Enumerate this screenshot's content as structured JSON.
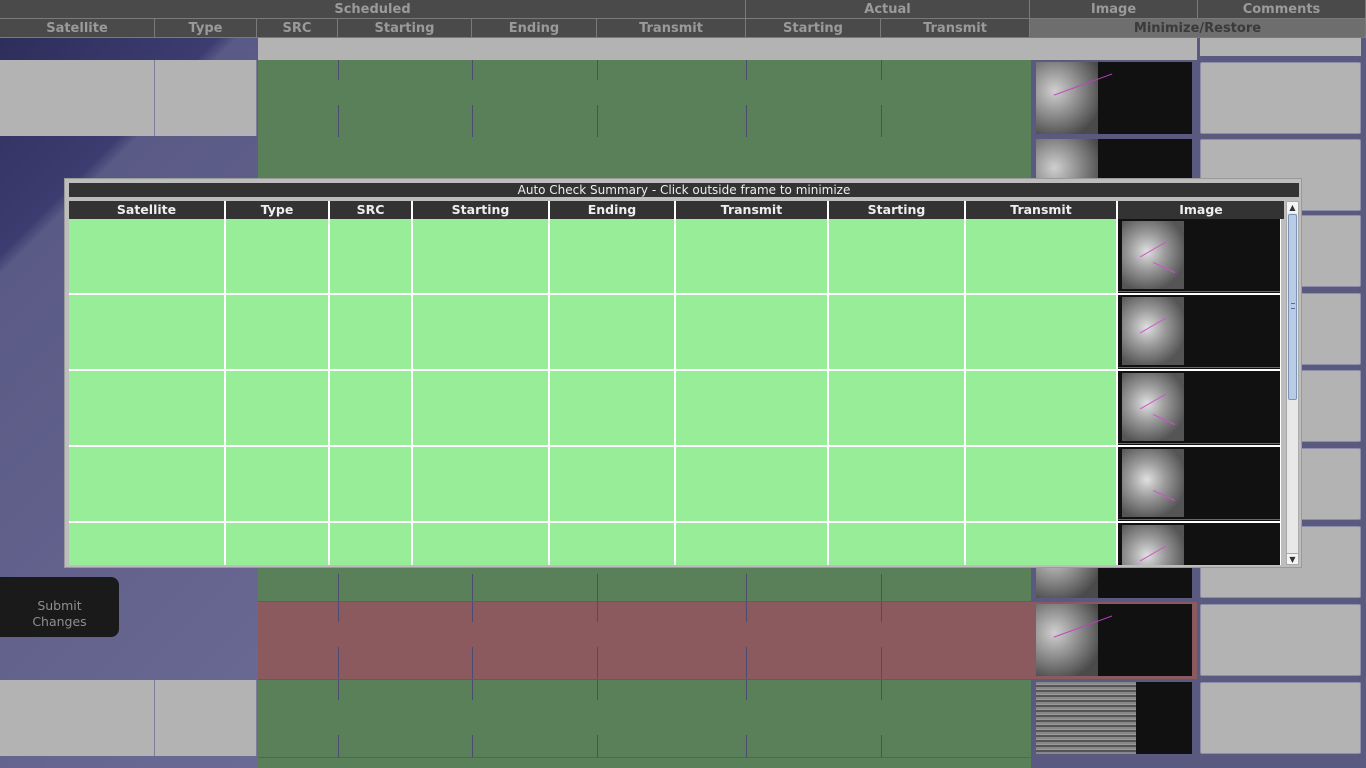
{
  "background": {
    "header_groups": [
      "Scheduled",
      "Actual",
      "Image",
      "Comments"
    ],
    "header_columns": [
      "Satellite",
      "Type",
      "SRC",
      "Starting",
      "Ending",
      "Transmit",
      "Starting",
      "Transmit",
      "Minimize/Restore"
    ],
    "submit_label_line1": "Submit",
    "submit_label_line2": "Changes"
  },
  "modal": {
    "title": "Auto Check Summary - Click outside frame to minimize",
    "columns": [
      "Satellite",
      "Type",
      "SRC",
      "Starting",
      "Ending",
      "Transmit",
      "Starting",
      "Transmit",
      "Image"
    ]
  },
  "colors": {
    "ok_row": "#98ee98",
    "bg_ok_band": "#5a8059",
    "bg_bad_band": "#8a5a5e"
  }
}
